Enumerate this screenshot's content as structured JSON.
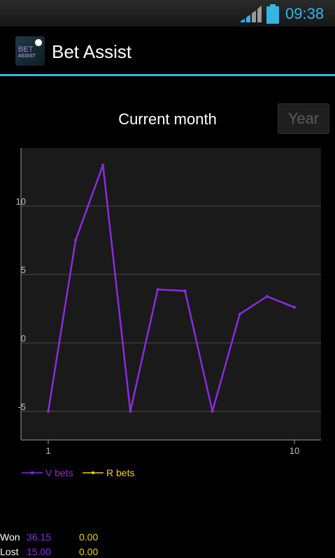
{
  "status_bar": {
    "time": "09:38",
    "accent_color": "#33b5e5",
    "icons": [
      "signal-icon",
      "battery-icon"
    ]
  },
  "action_bar": {
    "title": "Bet Assist",
    "icon": "app-icon"
  },
  "chart_header": {
    "title": "Current month",
    "year_button_label": "Year"
  },
  "chart_data": {
    "type": "line",
    "x": [
      1,
      2,
      3,
      4,
      5,
      6,
      7,
      8,
      9,
      10
    ],
    "series": [
      {
        "name": "V bets",
        "color": "#8a2be2",
        "values": [
          -5,
          7.5,
          13,
          -5,
          3.9,
          3.8,
          -5,
          2.1,
          3.4,
          2.6
        ]
      },
      {
        "name": "R bets",
        "color": "#f2d20f",
        "values": []
      }
    ],
    "xticks": [
      "1",
      "10"
    ],
    "yticks": [
      "-5",
      "0",
      "5",
      "10"
    ],
    "xlim": [
      0,
      11
    ],
    "ylim": [
      -7,
      14
    ],
    "grid": "horizontal",
    "legend": "bottom-left"
  },
  "summary": {
    "won": {
      "label": "Won",
      "v": "36.15",
      "r": "0.00"
    },
    "lost": {
      "label": "Lost",
      "v": "15.00",
      "r": "0.00"
    }
  }
}
